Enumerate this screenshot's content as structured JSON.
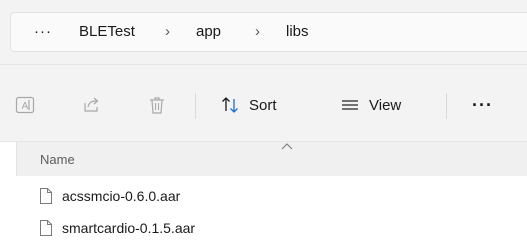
{
  "breadcrumb": {
    "overflow": "···",
    "items": [
      "BLETest",
      "app",
      "libs"
    ],
    "separator": "›"
  },
  "toolbar": {
    "rename_icon": "rename-icon",
    "share_icon": "share-icon",
    "delete_icon": "delete-icon",
    "sort_label": "Sort",
    "view_label": "View",
    "more": "···"
  },
  "columns": {
    "name": "Name"
  },
  "files": [
    {
      "name": "acssmcio-0.6.0.aar",
      "icon": "document-icon"
    },
    {
      "name": "smartcardio-0.1.5.aar",
      "icon": "document-icon"
    }
  ]
}
